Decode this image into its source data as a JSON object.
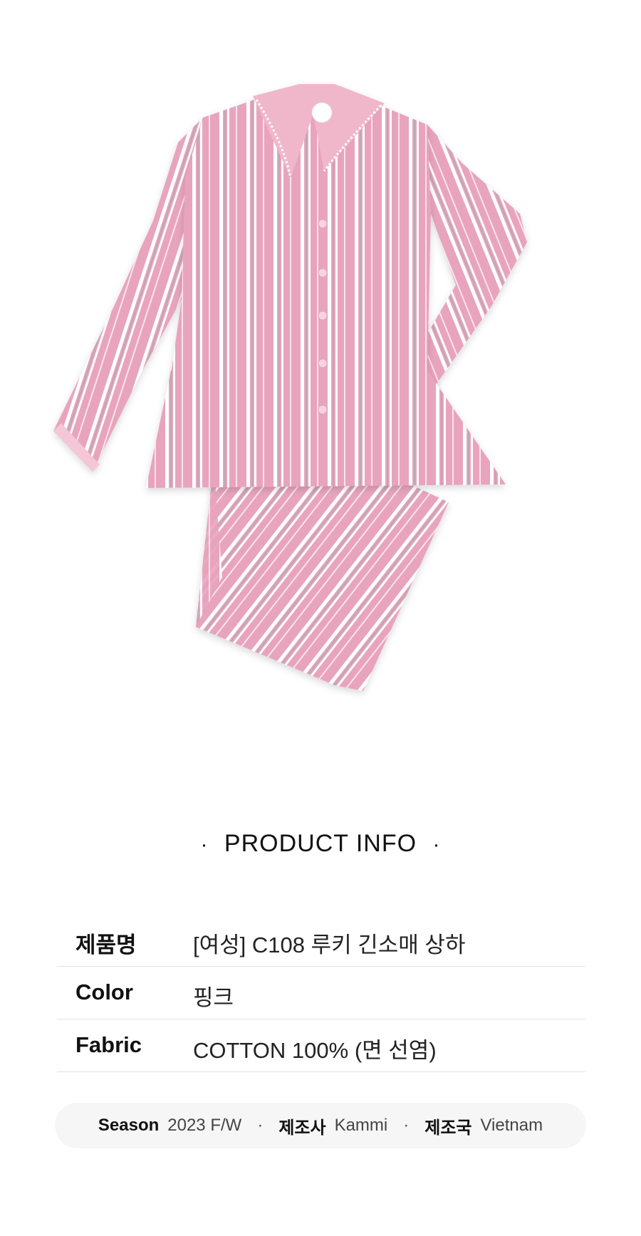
{
  "product_image": {
    "subject": "pink-striped-pajama-set"
  },
  "section": {
    "title": "PRODUCT INFO",
    "bullet_left": "·",
    "bullet_right": "·"
  },
  "info_rows": [
    {
      "label": "제품명",
      "value": "[여성] C108 루키 긴소매 상하"
    },
    {
      "label": "Color",
      "value": "핑크"
    },
    {
      "label": "Fabric",
      "value": "COTTON 100% (면 선염)"
    }
  ],
  "meta": {
    "season_label": "Season",
    "season_value": "2023 F/W",
    "maker_label": "제조사",
    "maker_value": "Kammi",
    "origin_label": "제조국",
    "origin_value": "Vietnam",
    "separator": "·"
  },
  "colors": {
    "fabric_pink": "#e8a4bd",
    "stripe_white": "#ffffff",
    "stripe_grey": "#b7a7ae",
    "background": "#ffffff"
  }
}
